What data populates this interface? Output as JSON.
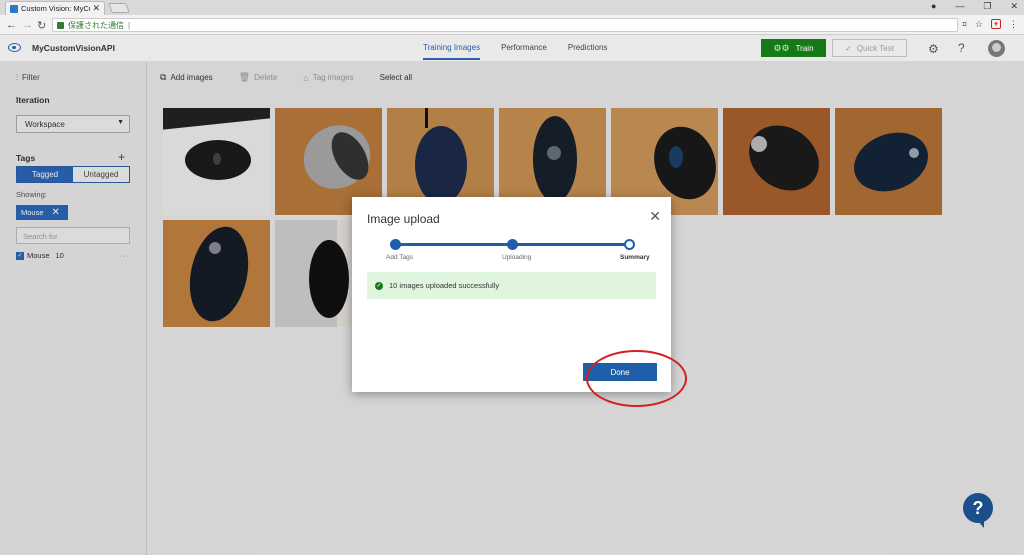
{
  "browser": {
    "tab_title": "Custom Vision: MyCusto",
    "tab_close": "✕",
    "secure_text": "保護された通信",
    "url_cursor": "|",
    "win_minimize": "—",
    "win_restore": "❐",
    "win_close": "✕",
    "user_icon_glyph": "●"
  },
  "header": {
    "project_name": "MyCustomVisionAPI",
    "tabs": [
      "Training Images",
      "Performance",
      "Predictions"
    ],
    "train_label": "Train",
    "quick_test_label": "Quick Test",
    "help_glyph": "?"
  },
  "sidebar": {
    "filter_label": "Filter",
    "iteration_heading": "Iteration",
    "iteration_value": "Workspace",
    "tags_heading": "Tags",
    "tagged_label": "Tagged",
    "untagged_label": "Untagged",
    "showing_label": "Showing:",
    "chip_label": "Mouse",
    "search_placeholder": "Search for",
    "tag_name": "Mouse",
    "tag_count": "10",
    "more_glyph": "···"
  },
  "toolbar": {
    "add_images": "Add images",
    "delete": "Delete",
    "tag_images": "Tag images",
    "select_all": "Select all"
  },
  "modal": {
    "title": "Image upload",
    "steps": [
      "Add Tags",
      "Uploading",
      "Summary"
    ],
    "success_message": "10 images uploaded successfully",
    "done_label": "Done"
  },
  "help_fab": "?",
  "colors": {
    "accent": "#1f5faa",
    "train_green": "#157a16",
    "success_bg": "#dff5dd",
    "annotation_red": "#d42020"
  }
}
